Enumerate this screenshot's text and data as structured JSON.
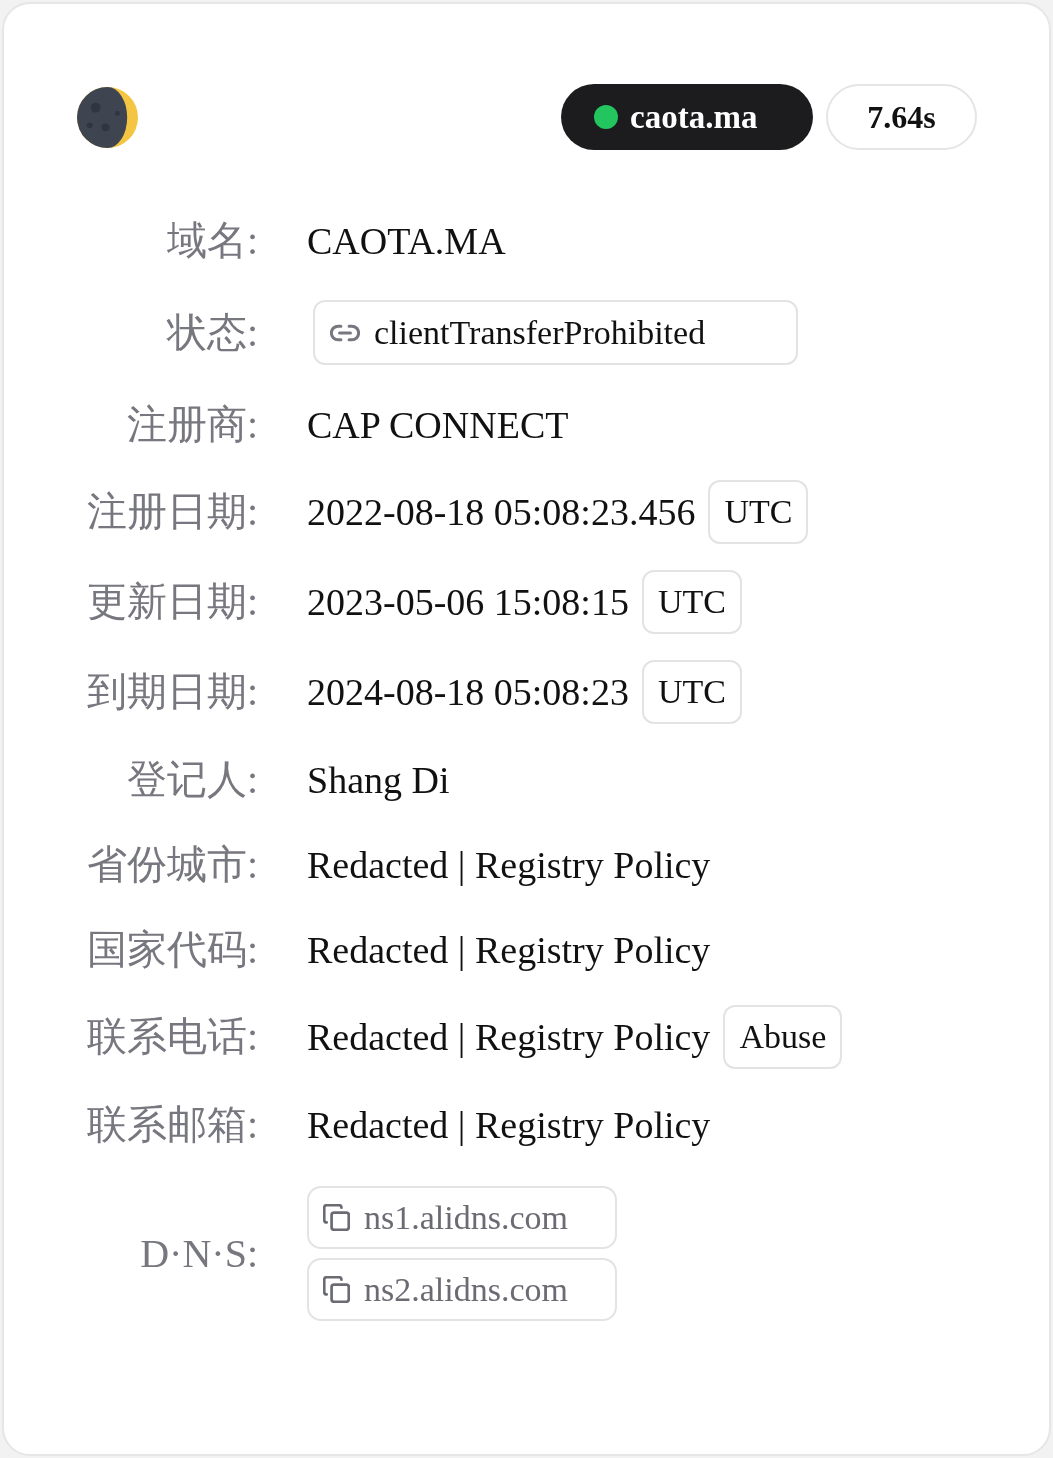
{
  "header": {
    "domain": {
      "name": "caota.ma",
      "color": "#22c55e"
    },
    "elapsed": "7.64s"
  },
  "fields": [
    {
      "kind": "text",
      "label": "域名:",
      "value": "CAOTA.MA"
    },
    {
      "kind": "status",
      "label": "状态:",
      "value": "clientTransferProhibited"
    },
    {
      "kind": "text",
      "label": "注册商:",
      "value": "CAP CONNECT"
    },
    {
      "kind": "text",
      "label": "注册日期:",
      "value": "2022-08-18 05:08:23.456",
      "tag": "UTC"
    },
    {
      "kind": "text",
      "label": "更新日期:",
      "value": "2023-05-06 15:08:15",
      "tag": "UTC"
    },
    {
      "kind": "text",
      "label": "到期日期:",
      "value": "2024-08-18 05:08:23",
      "tag": "UTC"
    },
    {
      "kind": "text",
      "label": "登记人:",
      "value": "Shang Di"
    },
    {
      "kind": "text",
      "label": "省份城市:",
      "value": "Redacted | Registry Policy"
    },
    {
      "kind": "text",
      "label": "国家代码:",
      "value": "Redacted | Registry Policy"
    },
    {
      "kind": "text",
      "label": "联系电话:",
      "value": "Redacted | Registry Policy",
      "tag": "Abuse"
    },
    {
      "kind": "text",
      "label": "联系邮箱:",
      "value": "Redacted | Registry Policy"
    },
    {
      "kind": "nameservers",
      "label": "D·N·S:",
      "values": [
        "ns1.alidns.com",
        "ns2.alidns.com"
      ]
    }
  ]
}
